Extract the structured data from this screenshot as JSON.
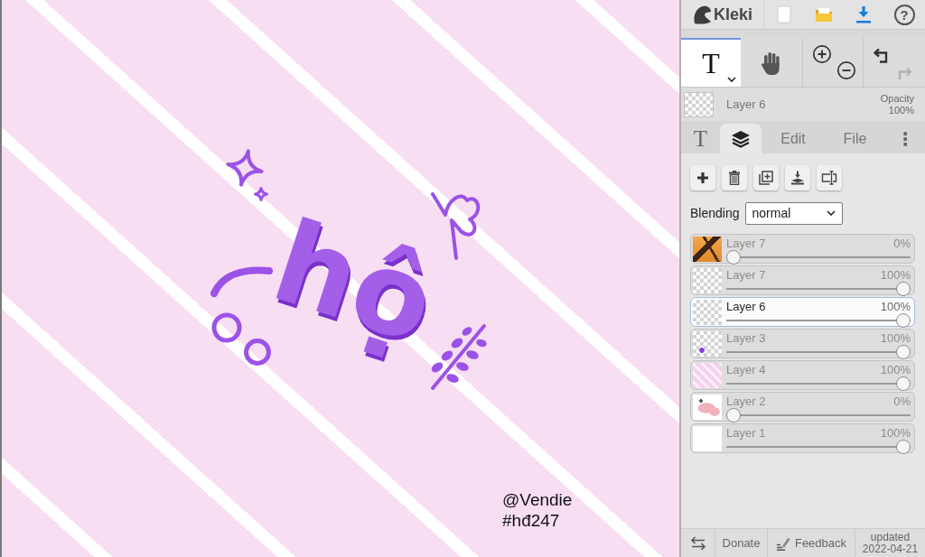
{
  "canvas": {
    "lettering": "hộ",
    "handle": "@Vendie",
    "hashtag": "#hđ247"
  },
  "top_bar": {
    "logo": "Kleki",
    "help": "?"
  },
  "tools": [
    {
      "kind": "text",
      "label": "T",
      "selected": true
    },
    {
      "kind": "hand",
      "selected": false
    }
  ],
  "history": [
    {
      "kind": "undo",
      "disabled": false
    },
    {
      "kind": "redo",
      "disabled": true
    }
  ],
  "current_layer": {
    "kind": "transparent",
    "name": "Layer 6",
    "opacity_label": "Opacity",
    "opacity": "100%"
  },
  "tabs": [
    {
      "kind": "text",
      "label": "T",
      "selected": false
    },
    {
      "kind": "layers",
      "selected": true
    },
    {
      "kind": "label",
      "label": "Edit",
      "selected": false
    },
    {
      "kind": "label",
      "label": "File",
      "selected": false
    },
    {
      "kind": "menu",
      "label": "⋮",
      "selected": false
    }
  ],
  "blending": {
    "label": "Blending",
    "value": "normal"
  },
  "layers": [
    {
      "name": "Layer 7",
      "opacity": "0%",
      "level": 0,
      "selected": false,
      "kind": "photo"
    },
    {
      "name": "Layer 7",
      "opacity": "100%",
      "level": 1,
      "selected": false,
      "kind": "transparent"
    },
    {
      "name": "Layer 6",
      "opacity": "100%",
      "level": 1,
      "selected": true,
      "kind": "transparent"
    },
    {
      "name": "Layer 3",
      "opacity": "100%",
      "level": 1,
      "selected": false,
      "kind": "sketch"
    },
    {
      "name": "Layer 4",
      "opacity": "100%",
      "level": 1,
      "selected": false,
      "kind": "stripes"
    },
    {
      "name": "Layer 2",
      "opacity": "0%",
      "level": 0,
      "selected": false,
      "kind": "blobs"
    },
    {
      "name": "Layer 1",
      "opacity": "100%",
      "level": 1,
      "selected": false,
      "kind": "blank"
    }
  ],
  "footer": {
    "donate": "Donate",
    "feedback": "Feedback",
    "updated": "updated 2022-04-21"
  }
}
